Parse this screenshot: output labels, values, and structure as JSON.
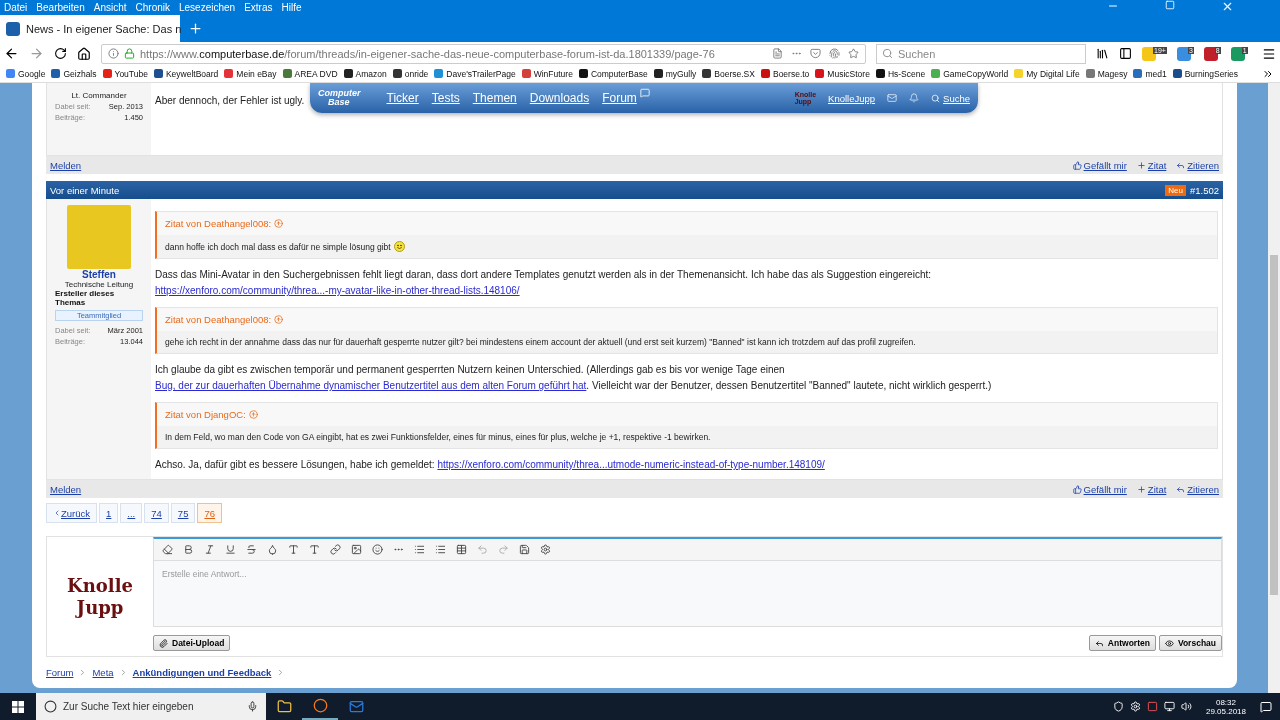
{
  "menu_bar": [
    "Datei",
    "Bearbeiten",
    "Ansicht",
    "Chronik",
    "Lesezeichen",
    "Extras",
    "Hilfe"
  ],
  "tabs": [
    {
      "label": "News - In eigener Sache: Das n",
      "selected": true
    }
  ],
  "address": {
    "url_prefix": "https://www.",
    "url_domain": "computerbase.de",
    "url_path": "/forum/threads/in-eigener-sache-das-neue-computerbase-forum-ist-da.1801339/page-76"
  },
  "search": {
    "placeholder": "Suchen"
  },
  "extension_badges": [
    "19+",
    "3",
    "8",
    "1"
  ],
  "bookmarks": [
    {
      "label": "Google",
      "color": "#4285f4"
    },
    {
      "label": "Geizhals",
      "color": "#1d5fa8"
    },
    {
      "label": "YouTube",
      "color": "#e62117"
    },
    {
      "label": "KeyweltBoard",
      "color": "#1d4f91"
    },
    {
      "label": "Mein eBay",
      "color": "#e53238"
    },
    {
      "label": "AREA DVD",
      "color": "#4a7a3a"
    },
    {
      "label": "Amazon",
      "color": "#222222"
    },
    {
      "label": "onride",
      "color": "#333333"
    },
    {
      "label": "Dave'sTrailerPage",
      "color": "#1e90d6"
    },
    {
      "label": "WinFuture",
      "color": "#d43f3a"
    },
    {
      "label": "ComputerBase",
      "color": "#111111"
    },
    {
      "label": "myGully",
      "color": "#222222"
    },
    {
      "label": "Boerse.SX",
      "color": "#333333"
    },
    {
      "label": "Boerse.to",
      "color": "#cc1111"
    },
    {
      "label": "MusicStore",
      "color": "#d9121b"
    },
    {
      "label": "Hs-Scene",
      "color": "#111111"
    },
    {
      "label": "GameCopyWorld",
      "color": "#4caf50"
    },
    {
      "label": "My Digital Life",
      "color": "#f5d327"
    },
    {
      "label": "Magesy",
      "color": "#777777"
    },
    {
      "label": "med1",
      "color": "#2a6ebb"
    },
    {
      "label": "BurningSeries",
      "color": "#1b4d8c"
    }
  ],
  "site_nav": {
    "logo": [
      "Computer",
      "Base"
    ],
    "links": [
      "Ticker",
      "Tests",
      "Themen",
      "Downloads",
      "Forum"
    ],
    "user": "KnolleJupp",
    "user_avatar": [
      "Knolle",
      "Jupp"
    ],
    "search": "Suche"
  },
  "posts": [
    {
      "rank": "Lt. Commander",
      "stats": [
        {
          "label": "Dabei seit:",
          "value": "Sep. 2013"
        },
        {
          "label": "Beiträge:",
          "value": "1.450"
        }
      ],
      "blocks": [
        {
          "kind": "paragraph",
          "parts": [
            {
              "kind": "text",
              "text": "Aber dennoch, der Fehler ist ugly."
            }
          ]
        }
      ],
      "report": "Melden",
      "actions": [
        "Gefällt mir",
        "Zitat",
        "Zitieren"
      ]
    },
    {
      "time": "Vor einer Minute",
      "badge": "Neu",
      "number": "#1.502",
      "author": "Steffen",
      "rank": "Technische Leitung",
      "creator": "Ersteller dieses Themas",
      "group": "Teammitglied",
      "stats": [
        {
          "label": "Dabei seit:",
          "value": "März 2001"
        },
        {
          "label": "Beiträge:",
          "value": "13.044"
        }
      ],
      "blocks": [
        {
          "kind": "quote",
          "source": "Zitat von Deathangel008:",
          "text": "dann hoffe ich doch mal dass es dafür ne simple lösung gibt"
        },
        {
          "kind": "paragraph",
          "parts": [
            {
              "kind": "text",
              "text": "Dass das Mini-Avatar in den Suchergebnissen fehlt liegt daran, dass dort andere Templates genutzt werden als in der Themenansicht. Ich habe das als Suggestion eingereicht: "
            },
            {
              "kind": "link",
              "text": "https://xenforo.com/community/threa...-my-avatar-like-in-other-thread-lists.148106/"
            }
          ]
        },
        {
          "kind": "quote",
          "source": "Zitat von Deathangel008:",
          "text": "gehe ich recht in der annahme dass das nur für dauerhaft gesperrte nutzer gilt? bei mindestens einem account der aktuell (und erst seit kurzem) \"Banned\" ist kann ich trotzdem auf das profil zugreifen."
        },
        {
          "kind": "paragraph",
          "parts": [
            {
              "kind": "text",
              "text": "Ich glaube da gibt es zwischen temporär und permanent gesperrten Nutzern keinen Unterschied. (Allerdings gab es bis vor wenige Tage einen "
            },
            {
              "kind": "link",
              "text": "Bug, der zur dauerhaften Übernahme dynamischer Benutzertitel aus dem alten Forum geführt hat"
            },
            {
              "kind": "text",
              "text": ". Vielleicht war der Benutzer, dessen Benutzertitel \"Banned\" lautete, nicht wirklich gesperrt.)"
            }
          ]
        },
        {
          "kind": "quote",
          "source": "Zitat von DjangOC:",
          "text": "In dem Feld, wo man den Code von GA eingibt, hat es zwei Funktionsfelder, eines für minus, eines für plus, welche je +1, respektive -1 bewirken."
        },
        {
          "kind": "paragraph",
          "parts": [
            {
              "kind": "text",
              "text": "Achso. Ja, dafür gibt es bessere Lösungen, habe ich gemeldet: "
            },
            {
              "kind": "link",
              "text": "https://xenforo.com/community/threa...utmode-numeric-instead-of-type-number.148109/"
            }
          ]
        }
      ],
      "report": "Melden",
      "actions": [
        "Gefällt mir",
        "Zitat",
        "Zitieren"
      ]
    }
  ],
  "pagination": {
    "prev": "Zurück",
    "pages": [
      {
        "label": "1",
        "selected": false
      },
      {
        "label": "...",
        "selected": false
      },
      {
        "label": "74",
        "selected": false
      },
      {
        "label": "75",
        "selected": false
      },
      {
        "label": "76",
        "selected": true
      }
    ]
  },
  "editor": {
    "avatar": [
      "Knolle",
      "Jupp"
    ],
    "placeholder": "Erstelle eine Antwort...",
    "upload": "Datei-Upload",
    "buttons": [
      "Antworten",
      "Vorschau"
    ]
  },
  "breadcrumb": [
    {
      "label": "Forum",
      "current": false
    },
    {
      "label": "Meta",
      "current": false
    },
    {
      "label": "Ankündigungen und Feedback",
      "current": true
    }
  ],
  "taskbar": {
    "search_placeholder": "Zur Suche Text hier eingeben",
    "time": "08:32",
    "date": "29.05.2018"
  }
}
